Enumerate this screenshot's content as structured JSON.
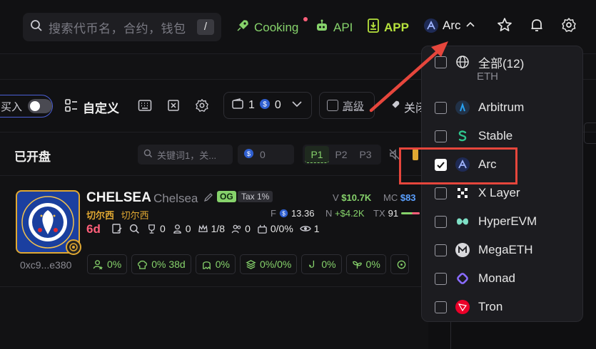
{
  "header": {
    "search_placeholder": "搜索代币名，合约，钱包",
    "search_shortcut": "/",
    "nav": [
      {
        "label": "Cooking",
        "icon": "rocket-icon"
      },
      {
        "label": "API",
        "icon": "robot-icon"
      },
      {
        "label": "APP",
        "icon": "download-icon"
      }
    ],
    "chain_selector": {
      "label": "Arc",
      "icon": "arc-logo-icon"
    }
  },
  "toolbar": {
    "toggle_label": "买入",
    "custom_label": "自定义",
    "wallet_count": "1",
    "coin_count": "0",
    "advanced_label": "高级",
    "off_label": "关闭"
  },
  "section": {
    "title": "已开盘",
    "keyword_placeholder": "关键词1，关...",
    "amount_value": "0",
    "presets": [
      "P1",
      "P2",
      "P3"
    ]
  },
  "token": {
    "name": "CHELSEA",
    "symbol": "Chelsea",
    "badge_og": "OG",
    "badge_tax": "Tax 1%",
    "name_zh": "切尔西",
    "name_zh2": "切尔西",
    "age": "6d",
    "address": "0xc9...e380",
    "stats": {
      "holders": "0",
      "devs": "0",
      "top": "1/8",
      "snipers": "0",
      "bundles": "0/0%",
      "views": "1"
    },
    "volume_label": "V",
    "volume": "$10.7K",
    "mc_label": "MC",
    "mc": "$83",
    "fee_label": "F",
    "fee": "13.36",
    "net_label": "N",
    "net": "+$4.2K",
    "tx_label": "TX",
    "tx": "91",
    "chips": [
      "0%",
      "0% 38d",
      "0%",
      "0%/0%",
      "0%",
      "0%"
    ]
  },
  "dropdown": {
    "items": [
      {
        "label": "全部(12)",
        "checked": false,
        "icon": "globe-icon"
      },
      {
        "label": "Arbitrum",
        "checked": false,
        "icon": "arbitrum-logo-icon"
      },
      {
        "label": "Stable",
        "checked": false,
        "icon": "stable-logo-icon"
      },
      {
        "label": "Arc",
        "checked": true,
        "icon": "arc-logo-icon"
      },
      {
        "label": "X Layer",
        "checked": false,
        "icon": "xlayer-logo-icon"
      },
      {
        "label": "HyperEVM",
        "checked": false,
        "icon": "hyperevm-logo-icon"
      },
      {
        "label": "MegaETH",
        "checked": false,
        "icon": "megaeth-logo-icon"
      },
      {
        "label": "Monad",
        "checked": false,
        "icon": "monad-logo-icon"
      },
      {
        "label": "Tron",
        "checked": false,
        "icon": "tron-logo-icon"
      }
    ],
    "partial_label": "ETH"
  },
  "colors": {
    "accent_green": "#86d26b",
    "annotation_red": "#e6463c",
    "gold": "#e0a832"
  }
}
